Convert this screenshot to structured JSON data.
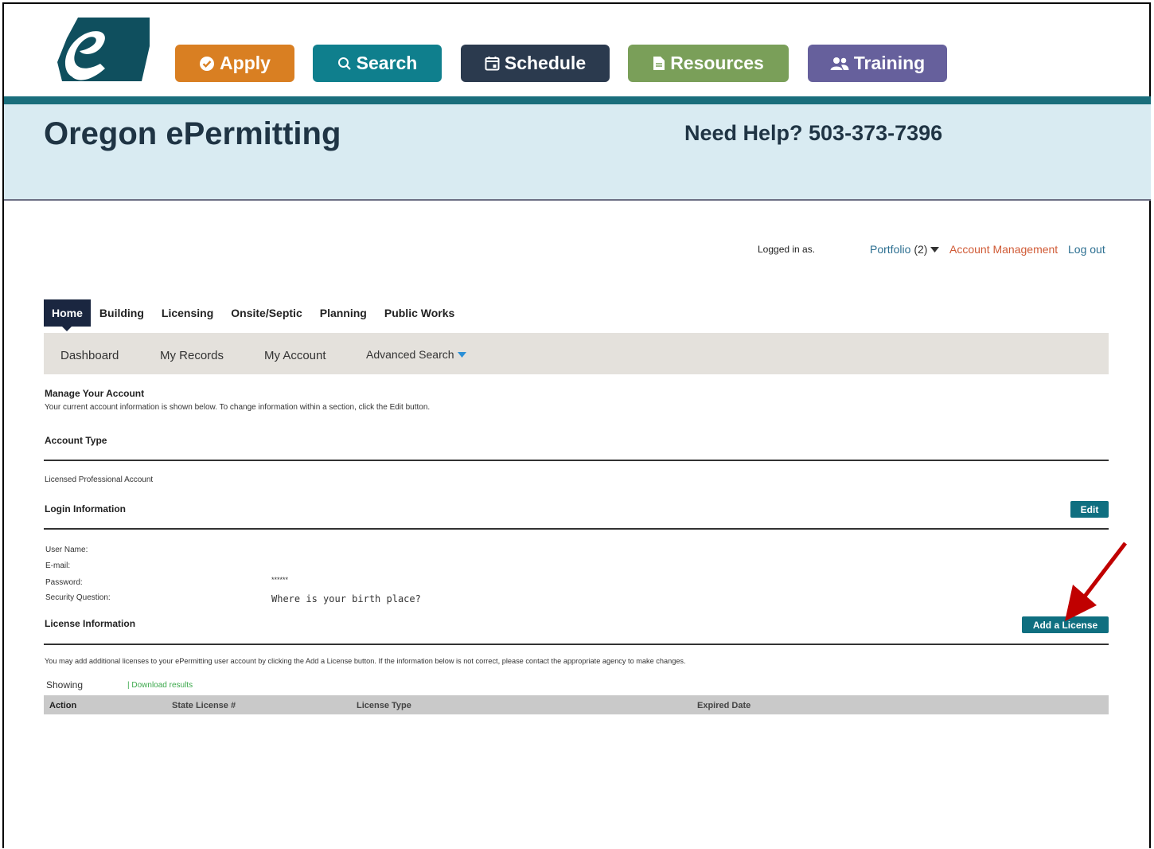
{
  "nav_buttons": {
    "apply": "Apply",
    "search": "Search",
    "schedule": "Schedule",
    "resources": "Resources",
    "training": "Training"
  },
  "header": {
    "title": "Oregon ePermitting",
    "help": "Need Help? 503-373-7396"
  },
  "user_bar": {
    "logged_in": "Logged in as.",
    "portfolio": "Portfolio",
    "portfolio_count": "(2)",
    "account_management": "Account Management",
    "logout": "Log out"
  },
  "module_tabs": [
    "Home",
    "Building",
    "Licensing",
    "Onsite/Septic",
    "Planning",
    "Public Works"
  ],
  "subnav": {
    "dashboard": "Dashboard",
    "my_records": "My Records",
    "my_account": "My Account",
    "advanced_search": "Advanced Search"
  },
  "manage": {
    "title": "Manage Your Account",
    "desc": "Your current account information is shown below. To change information within a section, click the Edit button."
  },
  "account_type": {
    "title": "Account Type",
    "value": "Licensed Professional Account"
  },
  "login_info": {
    "title": "Login Information",
    "edit_label": "Edit",
    "user_name_label": "User Name:",
    "email_label": "E-mail:",
    "password_label": "Password:",
    "password_value": "******",
    "security_label": "Security Question:",
    "security_value": "Where is your birth place?"
  },
  "license_info": {
    "title": "License Information",
    "add_label": "Add a License",
    "desc": "You may add additional licenses to your ePermitting user account by clicking the Add a License button. If the information below is not correct, please contact the appropriate agency to make changes.",
    "showing": "Showing",
    "download": "| Download results",
    "columns": [
      "Action",
      "State License #",
      "License Type",
      "Expired Date"
    ]
  },
  "colors": {
    "apply": "#d97f22",
    "search": "#0f7f8d",
    "schedule": "#2b3a4e",
    "resources": "#7a9f59",
    "training": "#66609c",
    "banner": "#d9ebf2",
    "accent": "#0f6f80",
    "arrow": "#c00000"
  }
}
